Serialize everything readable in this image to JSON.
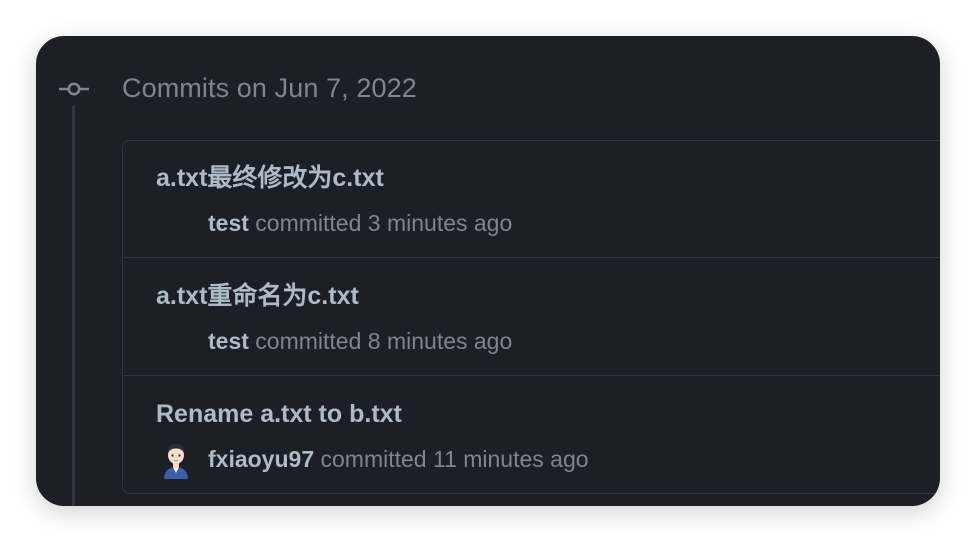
{
  "header": {
    "group_title": "Commits on Jun 7, 2022"
  },
  "commits": [
    {
      "title": "a.txt最终修改为c.txt",
      "author": "test",
      "verb": "committed",
      "time": "3 minutes ago",
      "has_avatar": false
    },
    {
      "title": "a.txt重命名为c.txt",
      "author": "test",
      "verb": "committed",
      "time": "8 minutes ago",
      "has_avatar": false
    },
    {
      "title": "Rename a.txt to b.txt",
      "author": "fxiaoyu97",
      "verb": "committed",
      "time": "11 minutes ago",
      "has_avatar": true
    }
  ],
  "icons": {
    "timeline": "git-commit-icon",
    "avatar": "user-avatar"
  },
  "colors": {
    "background": "#1c1f26",
    "border": "#30363d",
    "text_primary": "#adbac7",
    "text_muted": "#7d8590"
  }
}
